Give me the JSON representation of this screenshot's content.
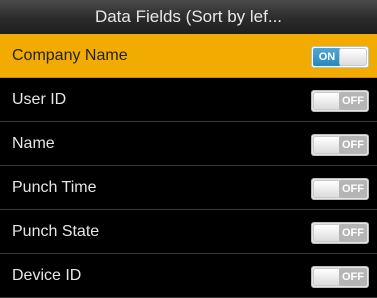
{
  "header": {
    "title": "Data Fields (Sort by lef..."
  },
  "fields": [
    {
      "label": "Company Name",
      "toggle": "ON",
      "enabled": true,
      "selected": true
    },
    {
      "label": "User ID",
      "toggle": "OFF",
      "enabled": false,
      "selected": false
    },
    {
      "label": "Name",
      "toggle": "OFF",
      "enabled": false,
      "selected": false
    },
    {
      "label": "Punch Time",
      "toggle": "OFF",
      "enabled": false,
      "selected": false
    },
    {
      "label": "Punch State",
      "toggle": "OFF",
      "enabled": false,
      "selected": false
    },
    {
      "label": "Device ID",
      "toggle": "OFF",
      "enabled": false,
      "selected": false
    }
  ],
  "colors": {
    "selected_row": "#f2ab00",
    "on_accent": "#2a86bb",
    "off_accent": "#b5b5b5"
  }
}
